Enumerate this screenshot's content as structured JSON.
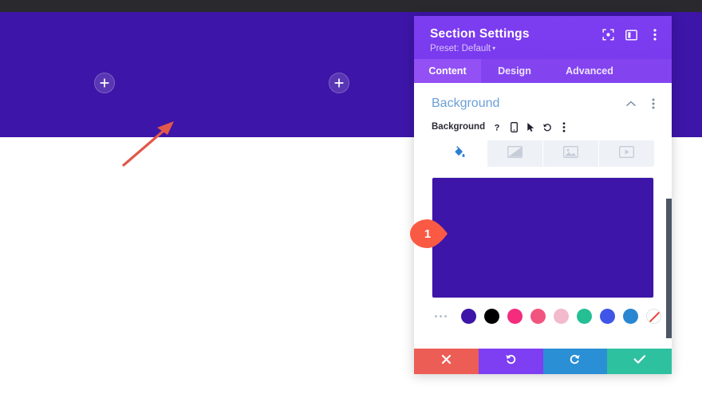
{
  "page": {
    "topbar_color": "#2a2a2e",
    "hero_background_color": "#3d15a8",
    "canvas_background_color": "#ffffff"
  },
  "hero": {
    "add_buttons": [
      {
        "name": "add-section-left",
        "icon": "plus-icon"
      },
      {
        "name": "add-section-right",
        "icon": "plus-icon"
      }
    ]
  },
  "annotation": {
    "arrow": {
      "icon": "arrow-up-right-icon",
      "color": "#e2584a"
    },
    "step_badge": {
      "number": "1",
      "color": "#fa5a43"
    }
  },
  "panel": {
    "title": "Section Settings",
    "preset_label": "Preset: Default",
    "preset_caret": "▾",
    "header_icons": [
      {
        "name": "focus-target-icon",
        "label": "Focus"
      },
      {
        "name": "layout-split-icon",
        "label": "Layout"
      },
      {
        "name": "kebab-menu-icon",
        "label": "More options"
      }
    ],
    "tabs": [
      {
        "label": "Content",
        "active": true
      },
      {
        "label": "Design",
        "active": false
      },
      {
        "label": "Advanced",
        "active": false
      }
    ],
    "section": {
      "title": "Background",
      "collapse_icon": "chevron-up-icon",
      "options_icon": "kebab-menu-icon"
    },
    "field": {
      "label": "Background",
      "icons": [
        {
          "name": "help-icon",
          "glyph": "?"
        },
        {
          "name": "responsive-device-icon",
          "glyph": "phone"
        },
        {
          "name": "hover-cursor-icon",
          "glyph": "cursor"
        },
        {
          "name": "reset-icon",
          "glyph": "undo"
        },
        {
          "name": "kebab-menu-icon",
          "glyph": "kebab"
        }
      ]
    },
    "background_types": [
      {
        "name": "background-color-tab",
        "icon": "paint-bucket-icon",
        "active": true
      },
      {
        "name": "background-gradient-tab",
        "icon": "gradient-icon",
        "active": false
      },
      {
        "name": "background-image-tab",
        "icon": "image-icon",
        "active": false
      },
      {
        "name": "background-video-tab",
        "icon": "video-icon",
        "active": false
      }
    ],
    "preview": {
      "name": "background-color-preview",
      "color": "#3d15a8"
    },
    "swatches": {
      "more_icon": "more-dots-icon",
      "colors": [
        {
          "name": "swatch-indigo",
          "hex": "#3d15a8"
        },
        {
          "name": "swatch-black",
          "hex": "#000000"
        },
        {
          "name": "swatch-pink",
          "hex": "#f32c7d"
        },
        {
          "name": "swatch-rose",
          "hex": "#f1557f"
        },
        {
          "name": "swatch-light-pink",
          "hex": "#f3b9cd"
        },
        {
          "name": "swatch-teal",
          "hex": "#25bf93"
        },
        {
          "name": "swatch-blue-violet",
          "hex": "#3f55e8"
        },
        {
          "name": "swatch-blue",
          "hex": "#2a86d0"
        },
        {
          "name": "swatch-transparent",
          "hex": "none"
        }
      ]
    },
    "actions": [
      {
        "name": "cancel-button",
        "icon": "close-icon",
        "color": "#ec5d56"
      },
      {
        "name": "undo-button",
        "icon": "undo-icon",
        "color": "#7e3ff2"
      },
      {
        "name": "redo-button",
        "icon": "redo-icon",
        "color": "#2a8fd4"
      },
      {
        "name": "save-button",
        "icon": "check-icon",
        "color": "#2ec1a0"
      }
    ],
    "scrollbar": {
      "name": "panel-scrollbar",
      "color": "#4c5666"
    }
  }
}
